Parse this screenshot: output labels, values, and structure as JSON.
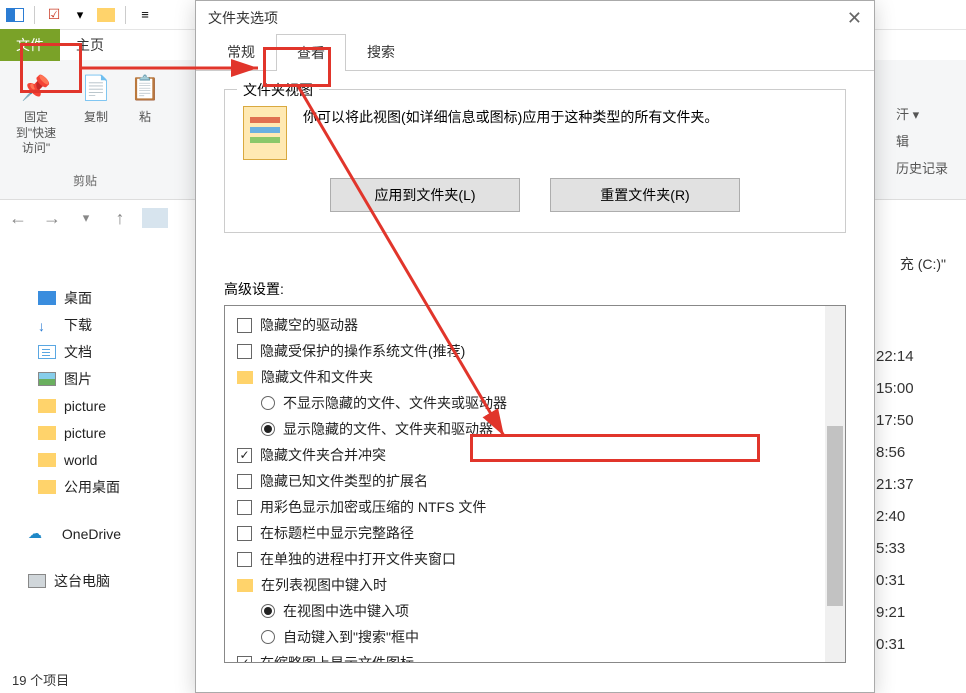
{
  "titlebar": {
    "dropdown_glyph": "≡"
  },
  "ribbon": {
    "tabs": {
      "file": "文件",
      "home": "主页"
    },
    "pin": "固定到\"快速访问\"",
    "copy": "复制",
    "paste": "粘",
    "clipboard_group": "剪贴"
  },
  "nav_arrows": {
    "back": "←",
    "forward": "→",
    "up": "↑"
  },
  "right_partial": {
    "open": "汗 ▾",
    "editor": "辑",
    "history": "历史记录"
  },
  "path_fragment": "充 (C:)\"",
  "leftnav": {
    "desktop": "桌面",
    "downloads": "下载",
    "documents": "文档",
    "pictures": "图片",
    "picture_a": "picture",
    "picture_b": "picture",
    "world": "world",
    "public_desktop": "公用桌面",
    "onedrive": "OneDrive",
    "this_pc": "这台电脑"
  },
  "times": [
    "22:14",
    "15:00",
    "17:50",
    "8:56",
    "21:37",
    "2:40",
    "5:33",
    "0:31",
    "9:21",
    "0:31"
  ],
  "status": "19 个项目",
  "dialog": {
    "title": "文件夹选项",
    "close_glyph": "✕",
    "tabs": {
      "general": "常规",
      "view": "查看",
      "search": "搜索"
    },
    "fv_legend": "文件夹视图",
    "fv_desc": "你可以将此视图(如详细信息或图标)应用于这种类型的所有文件夹。",
    "apply_btn": "应用到文件夹(L)",
    "reset_btn": "重置文件夹(R)",
    "adv_label": "高级设置:",
    "tree": {
      "hide_empty_drives": "隐藏空的驱动器",
      "hide_protected": "隐藏受保护的操作系统文件(推荐)",
      "hidden_files_folder": "隐藏文件和文件夹",
      "radio_hide": "不显示隐藏的文件、文件夹或驱动器",
      "radio_show": "显示隐藏的文件、文件夹和驱动器",
      "merge_conflict": "隐藏文件夹合并冲突",
      "hide_known_ext": "隐藏已知文件类型的扩展名",
      "ntfs_color": "用彩色显示加密或压缩的 NTFS 文件",
      "full_path": "在标题栏中显示完整路径",
      "separate_process": "在单独的进程中打开文件夹窗口",
      "list_typing": "在列表视图中键入时",
      "typing_select": "在视图中选中键入项",
      "typing_search": "自动键入到\"搜索\"框中",
      "thumb_icon": "在缩略图上显示文件图标"
    }
  }
}
